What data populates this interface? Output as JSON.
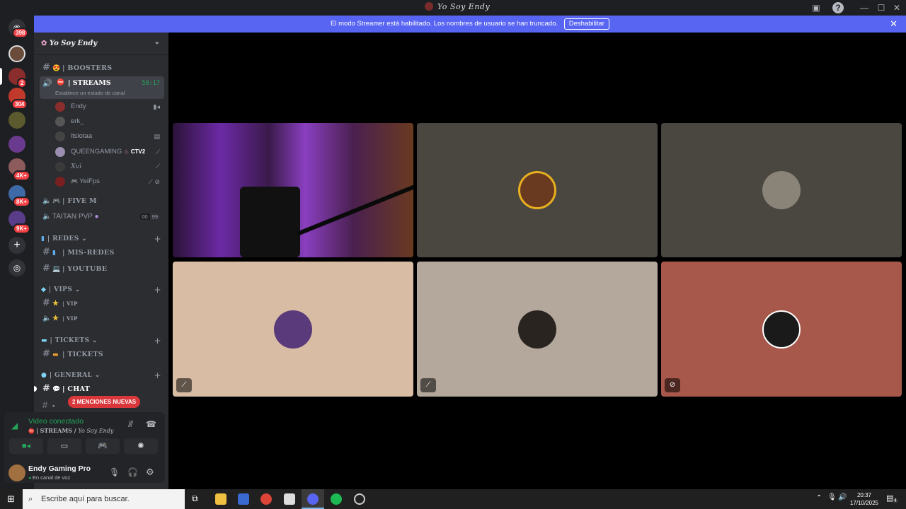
{
  "window": {
    "title": "Yo Soy Endy"
  },
  "banner": {
    "text": "El modo Streamer está habilitado. Los nombres de usuario se han truncado.",
    "button": "Deshabilitar"
  },
  "servers": {
    "badges": [
      "398",
      "2",
      "304",
      "4K+",
      "8K+",
      "9K+"
    ]
  },
  "guild": {
    "name": "Yo Soy Endy"
  },
  "channels": {
    "boosters": "| BOOSTERS",
    "streams": {
      "name": "| STREAMS",
      "time": "58:17",
      "status": "Establece un estado de canal"
    },
    "users": [
      {
        "name": "Endy",
        "color": "#8a2d2d"
      },
      {
        "name": "erk_",
        "color": "#555"
      },
      {
        "name": "ltslotaa",
        "color": "#444"
      },
      {
        "name": "QUEENGAMING",
        "tag": "CTV2",
        "color": "#9a8fb0"
      },
      {
        "name": "Xvi",
        "color": "#3a3a3a"
      },
      {
        "name": "YeiFps",
        "color": "#7a2020"
      }
    ],
    "fivem": "| FIVE M",
    "taitan": {
      "name": "TAITAN PVP",
      "a": "00",
      "b": "99"
    },
    "redes_cat": "| REDES",
    "misredes": "| MIS-REDES",
    "youtube": "| YOUTUBE",
    "vips_cat": "| VIPS",
    "vip1": "| VIP",
    "vip2": "| VIP",
    "tickets_cat": "| TICKETS",
    "tickets": "| TICKETS",
    "general_cat": "| GENERAL",
    "chat": "| CHAT"
  },
  "mentions": "2 MENCIONES NUEVAS",
  "voice": {
    "status": "Video conectado",
    "channel": "| STREAMS / ",
    "server": "Yo Soy Endy"
  },
  "user": {
    "name": "Endy Gaming Pro",
    "status": "En canal de voz"
  },
  "tiles": [
    {
      "bg": "#4a1f6e",
      "kind": "stream"
    },
    {
      "bg": "#4a4740"
    },
    {
      "bg": "#4a4740"
    },
    {
      "bg": "#d8bca4",
      "muted": true
    },
    {
      "bg": "#b4a89c",
      "muted": true
    },
    {
      "bg": "#a8574b",
      "muted": true
    }
  ],
  "taskbar": {
    "search": "Escribe aquí para buscar.",
    "time": "20:37",
    "date": "17/10/2025",
    "notif": "4"
  }
}
